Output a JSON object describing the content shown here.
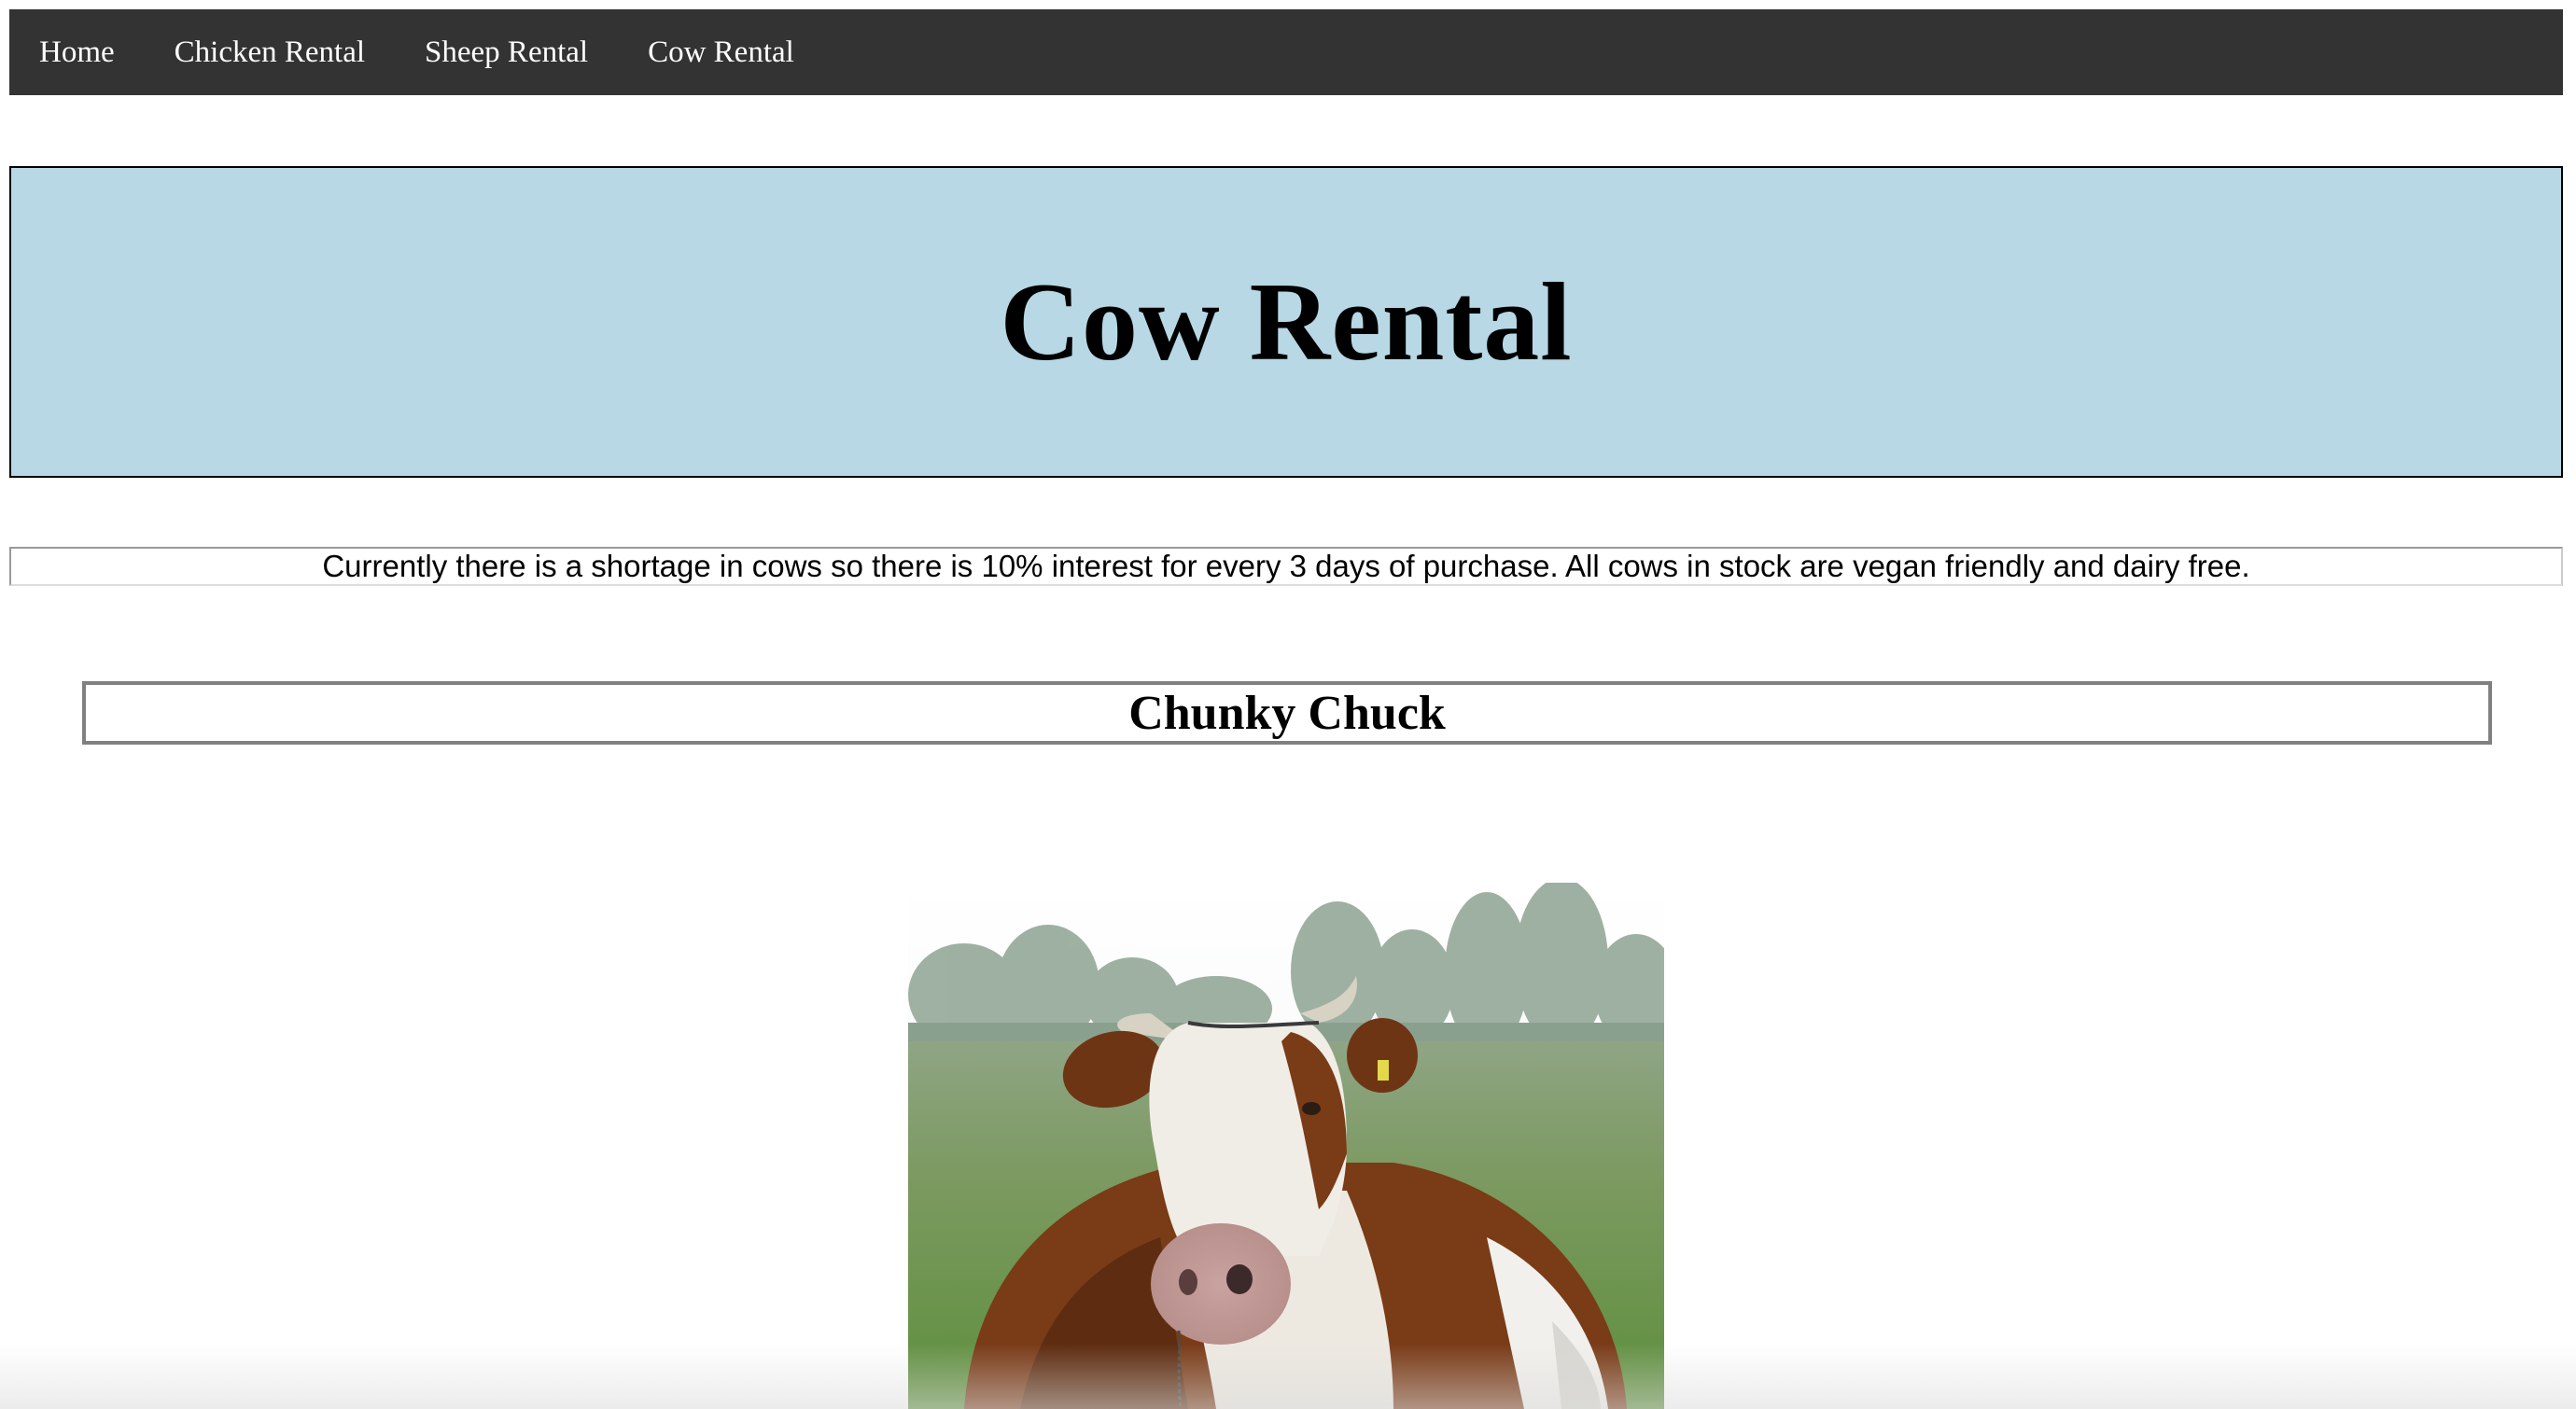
{
  "nav": {
    "items": [
      {
        "label": "Home"
      },
      {
        "label": "Chicken Rental"
      },
      {
        "label": "Sheep Rental"
      },
      {
        "label": "Cow Rental"
      }
    ]
  },
  "banner": {
    "title": "Cow Rental",
    "background": "#b7d8e4"
  },
  "notice": {
    "text": "Currently there is a shortage in cows so there is 10% interest for every 3 days of purchase. All cows in stock are vegan friendly and dairy free."
  },
  "cow": {
    "name": "Chunky Chuck",
    "photo_icon": "cow-photo"
  },
  "colors": {
    "nav_background": "#333333",
    "nav_text": "#ffffff"
  }
}
